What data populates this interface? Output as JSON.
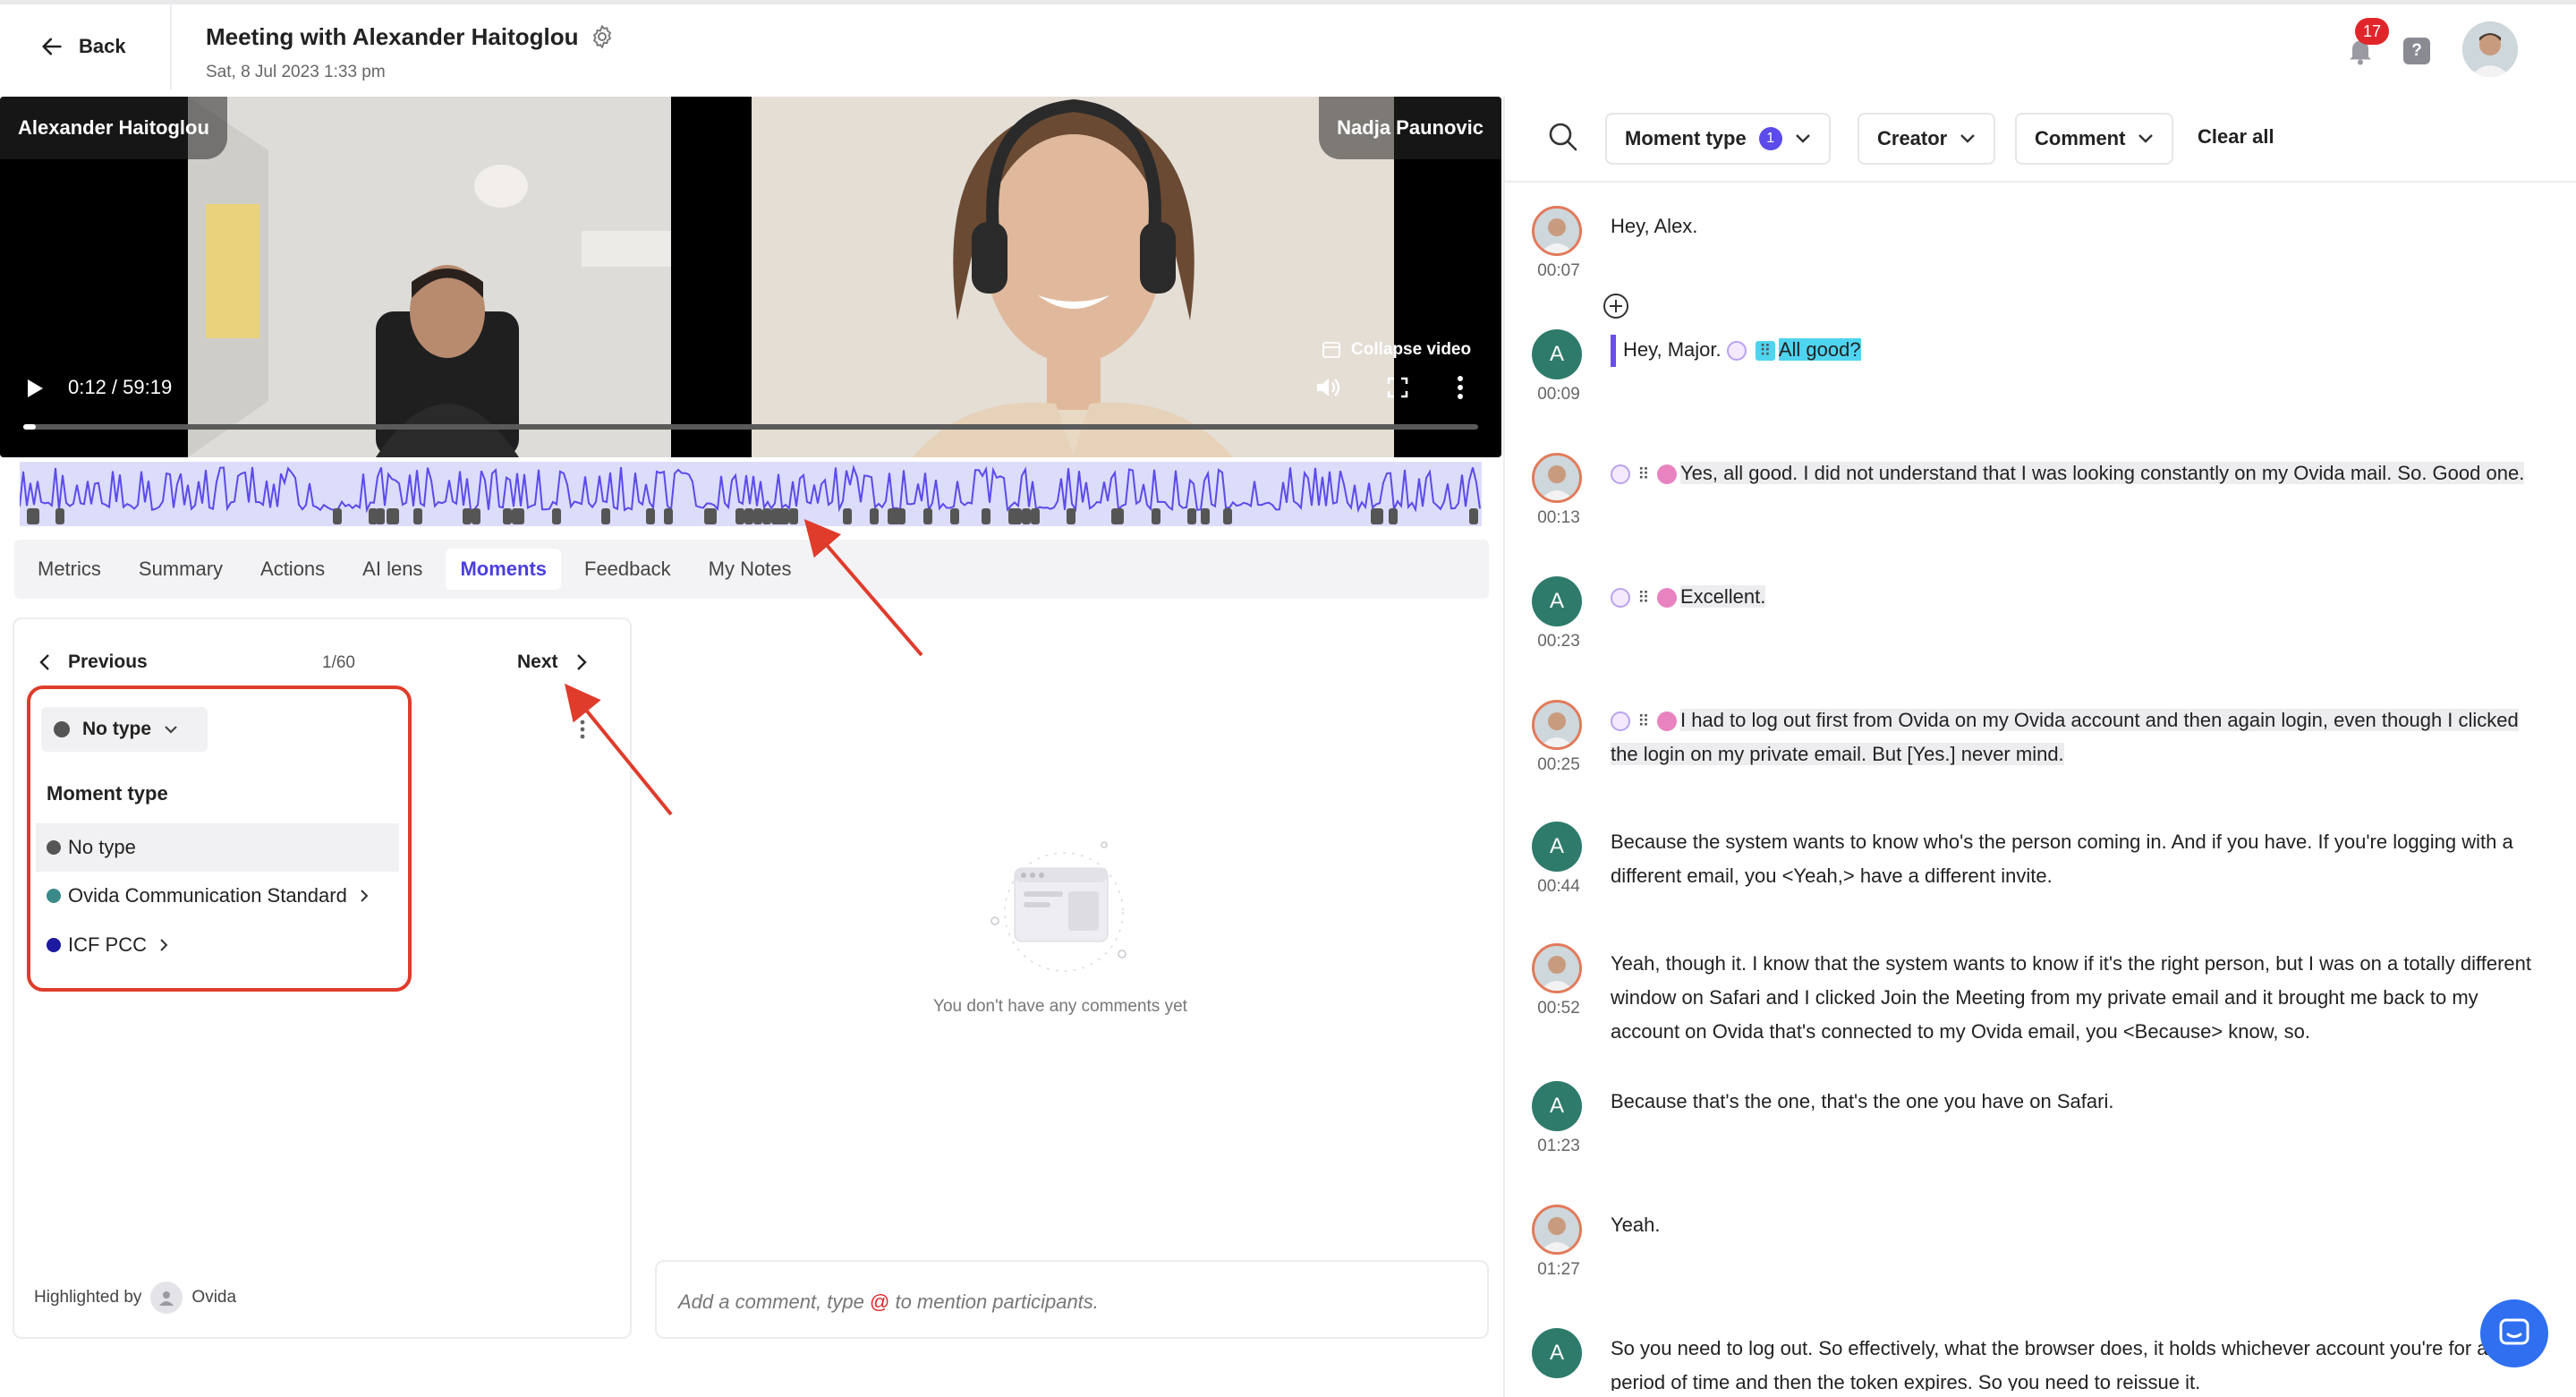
{
  "header": {
    "back_label": "Back",
    "title": "Meeting with Alexander Haitoglou",
    "date": "Sat, 8 Jul 2023 1:33 pm",
    "notification_count": "17",
    "help_label": "?"
  },
  "video": {
    "left_name": "Alexander Haitoglou",
    "right_name": "Nadja Paunovic",
    "collapse_label": "Collapse video",
    "time": "0:12 / 59:19",
    "progress_fraction": 0.003
  },
  "tabs": [
    "Metrics",
    "Summary",
    "Actions",
    "AI lens",
    "Moments",
    "Feedback",
    "My Notes"
  ],
  "active_tab": "Moments",
  "moments": {
    "previous_label": "Previous",
    "counter": "1/60",
    "next_label": "Next",
    "current_type": "No type",
    "type_title": "Moment type",
    "options": [
      {
        "label": "No type",
        "color": "#555555"
      },
      {
        "label": "Ovida Communication Standard",
        "color": "#3a8a8a"
      },
      {
        "label": "ICF PCC",
        "color": "#1c1aa0"
      }
    ],
    "highlighted_by_label": "Highlighted by",
    "highlighted_by_name": "Ovida"
  },
  "comments": {
    "empty_text": "You don't have any comments yet",
    "input_placeholder_before": "Add a comment, type ",
    "input_at": "@",
    "input_placeholder_after": " to mention participants."
  },
  "filters": {
    "moment_type_label": "Moment type",
    "moment_type_count": "1",
    "creator_label": "Creator",
    "comment_label": "Comment",
    "clear_all_label": "Clear all"
  },
  "transcript": [
    {
      "speaker": "photo",
      "time": "00:07",
      "text": "Hey, Alex."
    },
    {
      "speaker": "A",
      "time": "00:09",
      "text_a": "Hey, Major.",
      "text_b": "All good?"
    },
    {
      "speaker": "photo",
      "time": "00:13",
      "text": "Yes, all good. I did not understand that I was looking constantly on my Ovida mail. So. Good one."
    },
    {
      "speaker": "A",
      "time": "00:23",
      "text": "Excellent."
    },
    {
      "speaker": "photo",
      "time": "00:25",
      "text": "I had to log out first from Ovida on my Ovida account and then again login, even though I clicked the login on my private email. But [Yes.] never mind."
    },
    {
      "speaker": "A",
      "time": "00:44",
      "text": "Because the system wants to know who's the person coming in. And if you have. If you're logging with a different email, you <Yeah,> have a different invite."
    },
    {
      "speaker": "photo",
      "time": "00:52",
      "text": "Yeah, though it. I know that the system wants to know if it's the right person, but I was on a totally different window on Safari and I clicked Join the Meeting from my private email and it brought me back to my account on Ovida that's connected to my Ovida email, you <Because> know, so."
    },
    {
      "speaker": "A",
      "time": "01:23",
      "text": "Because that's the one, that's the one you have on Safari."
    },
    {
      "speaker": "photo",
      "time": "01:27",
      "text": "Yeah."
    },
    {
      "speaker": "A",
      "time": "",
      "text": "So you need to log out. So effectively, what the browser does, it holds whichever account you're for a period of time and then the token expires. So you need to reissue it."
    }
  ],
  "colors": {
    "accent": "#4a3fe0",
    "annotation_red": "#df3c2c",
    "speaker_a": "#2e7b6b",
    "wave": "#5b4bea"
  }
}
